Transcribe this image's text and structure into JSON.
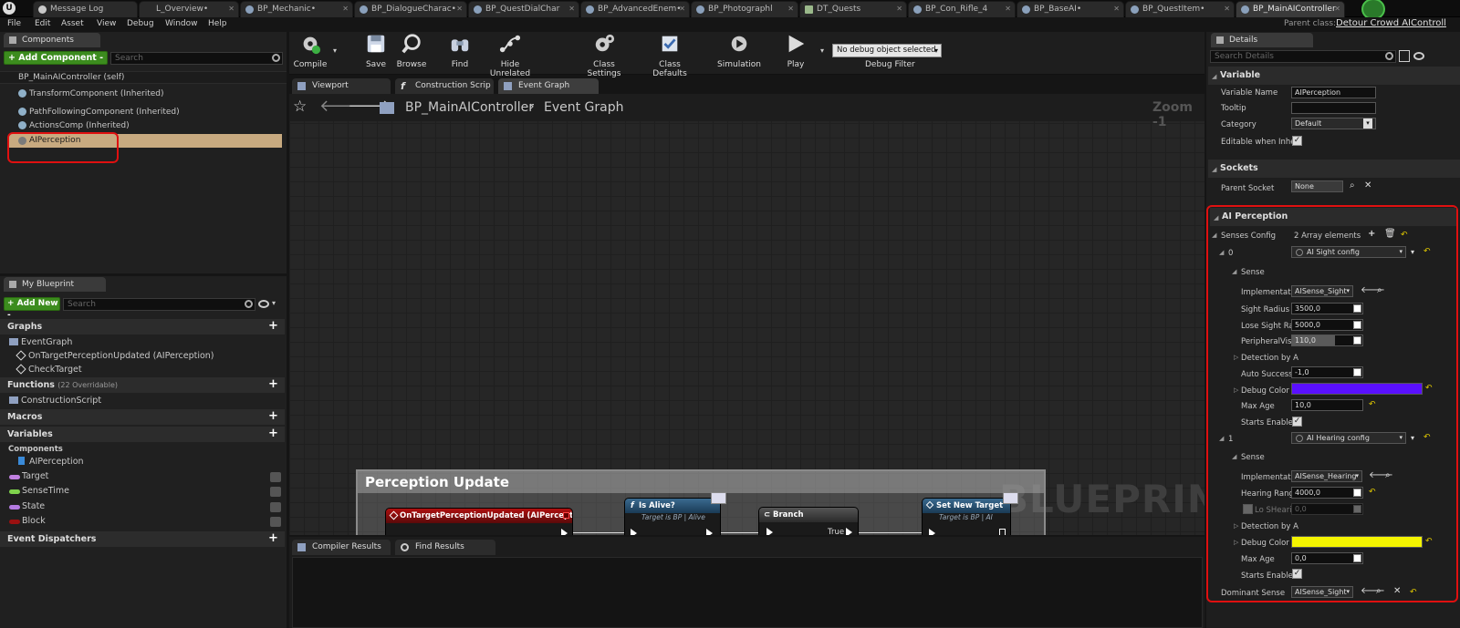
{
  "tabs": [
    {
      "label": "Message Log"
    },
    {
      "label": "L_Overview•"
    },
    {
      "label": "BP_Mechanic•"
    },
    {
      "label": "BP_DialogueCharac•"
    },
    {
      "label": "BP_QuestDialChar"
    },
    {
      "label": "BP_AdvancedEnem•"
    },
    {
      "label": "BP_Photographl"
    },
    {
      "label": "DT_Quests"
    },
    {
      "label": "BP_Con_Rifle_4"
    },
    {
      "label": "BP_BaseAI•"
    },
    {
      "label": "BP_QuestItem•"
    },
    {
      "label": "BP_MainAIController"
    }
  ],
  "menu": [
    "File",
    "Edit",
    "Asset",
    "View",
    "Debug",
    "Window",
    "Help"
  ],
  "parent_class": {
    "label": "Parent class:",
    "value": "Detour Crowd AIControll"
  },
  "components": {
    "title": "Components",
    "add_label": "+ Add Component -",
    "search_placeholder": "Search",
    "self_label": "BP_MainAIController (self)",
    "items": [
      {
        "label": "TransformComponent (Inherited)"
      },
      {
        "label": "PathFollowingComponent (Inherited)"
      },
      {
        "label": "ActionsComp (Inherited)"
      },
      {
        "label": "AIPerception"
      }
    ]
  },
  "my_blueprint": {
    "title": "My Blueprint",
    "add_label": "+ Add New -",
    "search_placeholder": "Search",
    "graphs_label": "Graphs",
    "event_graph_label": "EventGraph",
    "graph_items": [
      "OnTargetPerceptionUpdated (AIPerception)",
      "CheckTarget"
    ],
    "functions_label": "Functions",
    "functions_note": "(22 Overridable)",
    "construction_label": "ConstructionScript",
    "macros_label": "Macros",
    "variables_label": "Variables",
    "components_label": "Components",
    "component_var": "AIPerception",
    "variables": [
      {
        "name": "Target",
        "color": "#c080e0"
      },
      {
        "name": "SenseTime",
        "color": "#7fd34c"
      },
      {
        "name": "State",
        "color": "#b37ae0"
      },
      {
        "name": "Block",
        "color": "#9a1010"
      }
    ],
    "dispatchers_label": "Event Dispatchers"
  },
  "toolbar": {
    "compile": "Compile",
    "save": "Save",
    "browse": "Browse",
    "find": "Find",
    "hide_unrelated": "Hide Unrelated",
    "class_settings": "Class Settings",
    "class_defaults": "Class Defaults",
    "simulation": "Simulation",
    "play": "Play",
    "debug_select": "No debug object selected",
    "debug_filter": "Debug Filter"
  },
  "graph_tabs": [
    "Viewport",
    "Construction Scrip",
    "Event Graph"
  ],
  "graph": {
    "breadcrumb_root": "BP_MainAIController",
    "breadcrumb_leaf": "Event Graph",
    "zoom": "Zoom -1",
    "watermark": "BLUEPRINT",
    "comment_title": "Perception Update",
    "nodes": [
      {
        "title": "OnTargetPerceptionUpdated (AIPerception)",
        "sub": ""
      },
      {
        "title": "Is Alive?",
        "sub": "Target is BP | Alive"
      },
      {
        "title": "Branch",
        "sub": "",
        "pin": "True"
      },
      {
        "title": "Set New Target",
        "sub": "Target is BP | AI"
      }
    ]
  },
  "bottom_tabs": [
    "Compiler Results",
    "Find Results"
  ],
  "details": {
    "title": "Details",
    "search_placeholder": "Search Details",
    "variable_section": "Variable",
    "variable_name_label": "Variable Name",
    "variable_name": "AIPerception",
    "tooltip_label": "Tooltip",
    "tooltip": "",
    "category_label": "Category",
    "category": "Default",
    "editable_label": "Editable when Inheri",
    "sockets_section": "Sockets",
    "parent_socket_label": "Parent Socket",
    "parent_socket": "None",
    "ai_section": "AI Perception",
    "senses_label": "Senses Config",
    "senses_count": "2 Array elements",
    "sense0": {
      "index": "0",
      "config": "AI Sight config",
      "sense_label": "Sense",
      "impl_label": "Implementatic",
      "impl": "AISense_Sight",
      "sight_radius_label": "Sight Radius",
      "sight_radius": "3500,0",
      "lose_sight_label": "Lose Sight Ra",
      "lose_sight": "5000,0",
      "peripheral_label": "PeripheralVisi",
      "peripheral": "110,0",
      "detection_label": "Detection by A",
      "auto_success_label": "Auto Success",
      "auto_success": "-1,0",
      "debug_color_label": "Debug Color",
      "debug_color": "#5a10ff",
      "max_age_label": "Max Age",
      "max_age": "10,0",
      "starts_label": "Starts Enabled"
    },
    "sense1": {
      "index": "1",
      "config": "AI Hearing config",
      "sense_label": "Sense",
      "impl_label": "Implementatic",
      "impl": "AISense_Hearing",
      "hearing_label": "Hearing Range",
      "hearing": "4000,0",
      "lo_label": "Lo SHearir",
      "lo": "0,0",
      "detection_label": "Detection by A",
      "debug_color_label": "Debug Color",
      "debug_color": "#f5f500",
      "max_age_label": "Max Age",
      "max_age": "0,0",
      "starts_label": "Starts Enabled"
    },
    "dominant_label": "Dominant Sense",
    "dominant": "AISense_Sight"
  }
}
